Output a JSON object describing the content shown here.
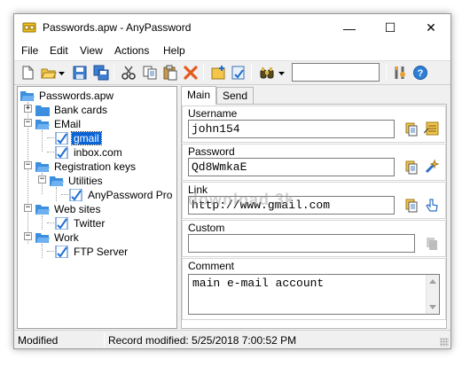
{
  "window": {
    "title": "Passwords.apw - AnyPassword",
    "minimize": "—",
    "maximize": "☐",
    "close": "✕"
  },
  "menu": [
    "File",
    "Edit",
    "View",
    "Actions",
    "Help"
  ],
  "toolbar": {
    "icons": [
      "new-file-icon",
      "open-folder-icon",
      "save-icon",
      "save-all-icon",
      "cut-icon",
      "copy-icon",
      "paste-icon",
      "delete-icon",
      "add-record-icon",
      "add-folder-icon",
      "find-icon",
      "options-icon",
      "help-icon"
    ],
    "search_value": ""
  },
  "tree": {
    "root": "Passwords.apw",
    "nodes": [
      {
        "label": "Bank cards",
        "type": "folder"
      },
      {
        "label": "EMail",
        "type": "folder"
      },
      {
        "label": "gmail",
        "type": "record",
        "selected": true
      },
      {
        "label": "inbox.com",
        "type": "record"
      },
      {
        "label": "Registration keys",
        "type": "folder"
      },
      {
        "label": "Utilities",
        "type": "folder"
      },
      {
        "label": "AnyPassword Pro",
        "type": "record"
      },
      {
        "label": "Web sites",
        "type": "folder"
      },
      {
        "label": "Twitter",
        "type": "record"
      },
      {
        "label": "Work",
        "type": "folder"
      },
      {
        "label": "FTP Server",
        "type": "record"
      }
    ]
  },
  "tabs": [
    {
      "label": "Main",
      "active": true
    },
    {
      "label": "Send",
      "active": false
    }
  ],
  "fields": {
    "username": {
      "label": "Username",
      "value": "john154"
    },
    "password": {
      "label": "Password",
      "value": "Qd8WmkaE"
    },
    "link": {
      "label": "Link",
      "value": "http://www.gmail.com"
    },
    "custom": {
      "label": "Custom",
      "value": ""
    },
    "comment": {
      "label": "Comment",
      "value": "main e-mail account"
    }
  },
  "status": {
    "state": "Modified",
    "record_modified": "Record modified: 5/25/2018 7:00:52 PM"
  },
  "watermark": "download 3k",
  "colors": {
    "selection": "#0a64d8",
    "folder": "#3c8ede",
    "chrome": "#f0f0f0"
  }
}
